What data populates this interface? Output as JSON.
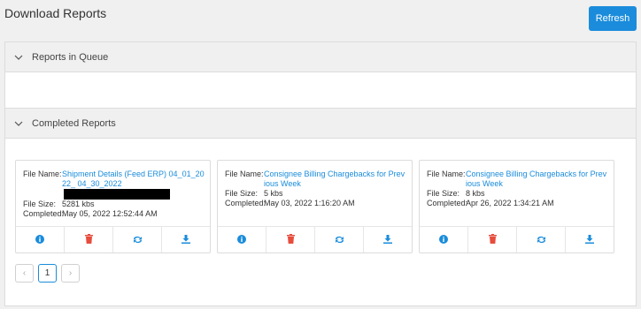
{
  "header": {
    "title": "Download Reports",
    "refresh_label": "Refresh"
  },
  "queue": {
    "title": "Reports in Queue"
  },
  "completed": {
    "title": "Completed Reports",
    "labels": {
      "file_name": "File Name:",
      "file_size": "File Size:",
      "completed": "Completed:"
    },
    "reports": [
      {
        "file_name": "Shipment Details (Feed ERP) 04_01_2022_ 04_30_2022",
        "file_name_redacted": true,
        "file_size": "5281 kbs",
        "completed": "May 05, 2022 12:52:44 AM"
      },
      {
        "file_name": "Consignee Billing Chargebacks for Previous Week",
        "file_size": "5 kbs",
        "completed": "May 03, 2022 1:16:20 AM"
      },
      {
        "file_name": "Consignee Billing Chargebacks for Previous Week",
        "file_size": "8 kbs",
        "completed": "Apr 26, 2022 1:34:21 AM"
      }
    ],
    "actions": [
      "info-icon",
      "delete-icon",
      "retry-icon",
      "download-icon"
    ],
    "action_colors": {
      "info": "#1a8cdb",
      "delete": "#e74c3c",
      "retry": "#1a8cdb",
      "download": "#1a8cdb"
    }
  },
  "pagination": {
    "prev": "‹",
    "current": "1",
    "next": "›"
  }
}
